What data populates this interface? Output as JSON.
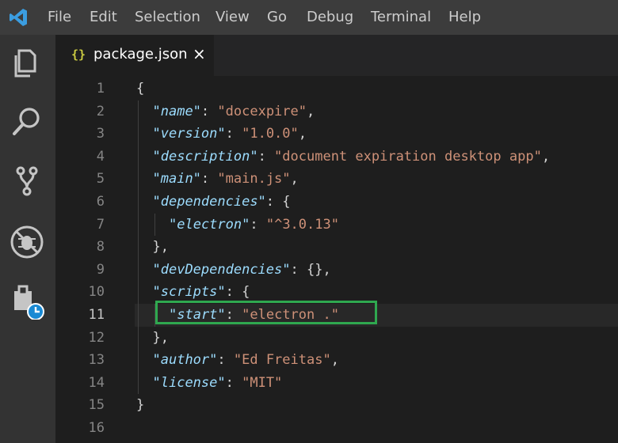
{
  "menu": [
    "File",
    "Edit",
    "Selection",
    "View",
    "Go",
    "Debug",
    "Terminal",
    "Help"
  ],
  "tab": {
    "icon": "{}",
    "title": "package.json",
    "close": "×"
  },
  "activity_icons": [
    "files-icon",
    "search-icon",
    "source-control-icon",
    "debug-icon",
    "extensions-history-icon"
  ],
  "code_lines": [
    {
      "num": "1",
      "indent": 0,
      "tokens": [
        {
          "t": "p",
          "v": "{"
        }
      ]
    },
    {
      "num": "2",
      "indent": 1,
      "tokens": [
        {
          "t": "k",
          "v": "\"name\""
        },
        {
          "t": "p",
          "v": ": "
        },
        {
          "t": "s",
          "v": "\"docexpire\""
        },
        {
          "t": "p",
          "v": ","
        }
      ]
    },
    {
      "num": "3",
      "indent": 1,
      "tokens": [
        {
          "t": "k",
          "v": "\"version\""
        },
        {
          "t": "p",
          "v": ": "
        },
        {
          "t": "s",
          "v": "\"1.0.0\""
        },
        {
          "t": "p",
          "v": ","
        }
      ]
    },
    {
      "num": "4",
      "indent": 1,
      "tokens": [
        {
          "t": "k",
          "v": "\"description\""
        },
        {
          "t": "p",
          "v": ": "
        },
        {
          "t": "s",
          "v": "\"document expiration desktop app\""
        },
        {
          "t": "p",
          "v": ","
        }
      ]
    },
    {
      "num": "5",
      "indent": 1,
      "tokens": [
        {
          "t": "k",
          "v": "\"main\""
        },
        {
          "t": "p",
          "v": ": "
        },
        {
          "t": "s",
          "v": "\"main.js\""
        },
        {
          "t": "p",
          "v": ","
        }
      ]
    },
    {
      "num": "6",
      "indent": 1,
      "tokens": [
        {
          "t": "k",
          "v": "\"dependencies\""
        },
        {
          "t": "p",
          "v": ": {"
        }
      ]
    },
    {
      "num": "7",
      "indent": 2,
      "tokens": [
        {
          "t": "k",
          "v": "\"electron\""
        },
        {
          "t": "p",
          "v": ": "
        },
        {
          "t": "s",
          "v": "\"^3.0.13\""
        }
      ]
    },
    {
      "num": "8",
      "indent": 1,
      "tokens": [
        {
          "t": "p",
          "v": "},"
        }
      ]
    },
    {
      "num": "9",
      "indent": 1,
      "tokens": [
        {
          "t": "k",
          "v": "\"devDependencies\""
        },
        {
          "t": "p",
          "v": ": {},"
        }
      ]
    },
    {
      "num": "10",
      "indent": 1,
      "tokens": [
        {
          "t": "k",
          "v": "\"scripts\""
        },
        {
          "t": "p",
          "v": ": {"
        }
      ]
    },
    {
      "num": "11",
      "indent": 2,
      "tokens": [
        {
          "t": "k",
          "v": "\"start\""
        },
        {
          "t": "p",
          "v": ": "
        },
        {
          "t": "s",
          "v": "\"electron .\""
        }
      ]
    },
    {
      "num": "12",
      "indent": 1,
      "tokens": [
        {
          "t": "p",
          "v": "},"
        }
      ]
    },
    {
      "num": "13",
      "indent": 1,
      "tokens": [
        {
          "t": "k",
          "v": "\"author\""
        },
        {
          "t": "p",
          "v": ": "
        },
        {
          "t": "s",
          "v": "\"Ed Freitas\""
        },
        {
          "t": "p",
          "v": ","
        }
      ]
    },
    {
      "num": "14",
      "indent": 1,
      "tokens": [
        {
          "t": "k",
          "v": "\"license\""
        },
        {
          "t": "p",
          "v": ": "
        },
        {
          "t": "s",
          "v": "\"MIT\""
        }
      ]
    },
    {
      "num": "15",
      "indent": 0,
      "tokens": [
        {
          "t": "p",
          "v": "}"
        }
      ]
    },
    {
      "num": "16",
      "indent": 0,
      "tokens": []
    }
  ],
  "active_line": "11",
  "colors": {
    "key": "#9cdcfe",
    "string": "#ce9178",
    "punct": "#d4d4d4",
    "highlight": "#2fa84f"
  }
}
